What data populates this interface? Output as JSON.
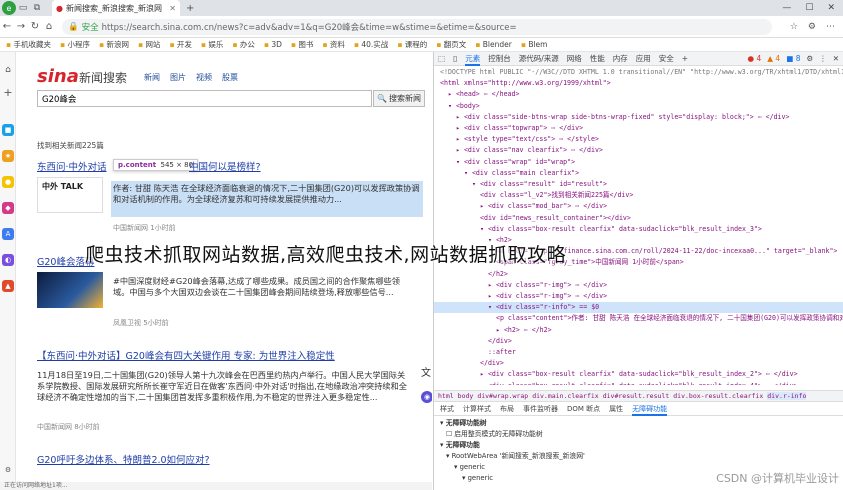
{
  "browser": {
    "tab_title": "新闻搜索_新浪搜索_新浪网",
    "url_secure_label": "安全",
    "url": "https://search.sina.com.cn/news?c=adv&adv=1&q=G20峰会&time=w&stime=&etime=&source=",
    "bookmarks": [
      "手机收藏夹",
      "小程序",
      "新浪网",
      "网站",
      "开发",
      "娱乐",
      "办公",
      "3D",
      "图书",
      "资料",
      "40.实战",
      "课程的",
      "翻页文",
      "Blender",
      "Blem"
    ]
  },
  "page": {
    "logo": "sina",
    "logo_subtitle": "新闻搜索",
    "nav": [
      "新闻",
      "图片",
      "视频",
      "股票"
    ],
    "search": {
      "value": "G20峰会",
      "button": "搜索新闻"
    },
    "result_count": "找到相关新闻225篇",
    "tooltip": {
      "selector": "p.content",
      "size": "545 × 80"
    },
    "results": [
      {
        "title": "东西问·中外对话",
        "title_tail": "中国何以是榜样?",
        "thumb_text": "中外 TALK",
        "body": "作者: 甘甜 陈天浩 在全球经济面临衰退的情况下,二十国集团(G20)可以发挥政策协调和对话机制的作用。为全球经济复苏和可持续发展提供推动力...",
        "meta": "中国新闻网 1小时前"
      },
      {
        "title": "G20峰会落幕",
        "body": "#中国深度财经#G20峰会落幕,达成了哪些成果。成员国之间的合作聚焦哪些领域。中国与多个大国双边会谈在二十国集团峰会期间陆续登场,释放哪些信号...",
        "meta": "凤凰卫视 5小时前"
      },
      {
        "title": "【东西问·中外对话】G20峰会有四大关键作用 专家: 为世界注入稳定性",
        "body": "11月18日至19日,二十国集团(G20)领导人第十九次峰会在巴西里约热内卢举行。中国人民大学国际关系学院教授、国际发展研究所所长崔守军近日在做客'东西问·中外对话'时指出,在地缘政治冲突持续和全球经济不确定性增加的当下,二十国集团首发挥多重积极作用,为不稳定的世界注入更多稳定性...",
        "meta": "中国新闻网 8小时前"
      },
      {
        "title": "G20呼吁多边体系、特朗普2.0如何应对?",
        "body": "",
        "meta": ""
      }
    ],
    "status_text": "正在访问网络地址1项..."
  },
  "overlay_heading": "爬虫技术抓取网站数据,高效爬虫技术,网站数据抓取攻略",
  "devtools": {
    "tabs": [
      "元素",
      "控制台",
      "源代码/来源",
      "网络",
      "性能",
      "内存",
      "应用",
      "安全"
    ],
    "active_tab": "元素",
    "badges": [
      "4",
      "4",
      "8"
    ],
    "dom_lines": [
      {
        "i": 0,
        "t": "<!DOCTYPE html PUBLIC \"-//W3C//DTD XHTML 1.0 transitional//EN\" \"http://www.w3.org/TR/xhtml1/DTD/xhtml1-transitional.dtd\">",
        "c": "cm"
      },
      {
        "i": 0,
        "t": "<html xmlns=\"http://www.w3.org/1999/xhtml\">"
      },
      {
        "i": 1,
        "t": "▸ <head> ⋯ </head>"
      },
      {
        "i": 1,
        "t": "▾ <body>"
      },
      {
        "i": 2,
        "t": "▸ <div class=\"side-btns-wrap side-btns-wrap-fixed\" style=\"display: block;\"> ⋯ </div>"
      },
      {
        "i": 2,
        "t": "▸ <div class=\"topwrap\"> ⋯ </div>"
      },
      {
        "i": 2,
        "t": "▸ <style type=\"text/css\"> ⋯ </style>"
      },
      {
        "i": 2,
        "t": "▸ <div class=\"nav clearfix\"> ⋯ </div>"
      },
      {
        "i": 2,
        "t": "▾ <div class=\"wrap\" id=\"wrap\">"
      },
      {
        "i": 3,
        "t": "▾ <div class=\"main clearfix\">"
      },
      {
        "i": 4,
        "t": "▾ <div class=\"result\" id=\"result\">"
      },
      {
        "i": 5,
        "t": "<div class=\"l_v2\">找到相关新闻225篇</div>"
      },
      {
        "i": 5,
        "t": "▸ <div class=\"mod_bar\"> ⋯ </div>"
      },
      {
        "i": 5,
        "t": "<div id=\"news_result_container\"></div>"
      },
      {
        "i": 5,
        "t": "▾ <div class=\"box-result clearfix\" data-sudaclick=\"blk_result_index_3\">"
      },
      {
        "i": 6,
        "t": "▾ <h2>"
      },
      {
        "i": 7,
        "t": "<a href=\"https://finance.sina.com.cn/roll/2024-11-22/doc-incexaa0...\" target=\"_blank\">"
      },
      {
        "i": 7,
        "t": "<span class=\"fgray_time\">中国新闻网 1小时前</span>"
      },
      {
        "i": 6,
        "t": "</h2>"
      },
      {
        "i": 6,
        "t": "▸ <div class=\"r-img\"> ⋯ </div>"
      },
      {
        "i": 6,
        "t": "▸ <div class=\"r-img\"> ⋯ </div>"
      },
      {
        "i": 6,
        "t": "▾ <div class=\"r-info\"> == $0",
        "sel": true
      },
      {
        "i": 7,
        "t": "<p class=\"content\">作者: 甘甜 陈天浩 在全球经济面临衰退的情况下, 二十国集团(G20)可以发挥政策协调和对话机制的作用。为全球经济复苏和可持续发展提供推动力...</p>"
      },
      {
        "i": 7,
        "t": "▸ <h2> ⋯ </h2>"
      },
      {
        "i": 6,
        "t": "</div>"
      },
      {
        "i": 6,
        "t": "::after"
      },
      {
        "i": 5,
        "t": "</div>"
      },
      {
        "i": 5,
        "t": "▸ <div class=\"box-result clearfix\" data-sudaclick=\"blk_result_index_2\"> ⋯ </div>"
      },
      {
        "i": 5,
        "t": "▸ <div class=\"box-result clearfix\" data-sudaclick=\"blk_result_index_4\"> ⋯ </div>"
      }
    ],
    "crumbs": [
      "html",
      "body",
      "div#wrap.wrap",
      "div.main.clearfix",
      "div#result.result",
      "div.box-result.clearfix",
      "div.r-info"
    ],
    "subtabs": [
      "样式",
      "计算样式",
      "布局",
      "事件监听器",
      "DOM 断点",
      "属性",
      "无障碍功能"
    ],
    "active_subtab": "无障碍功能",
    "a11y": {
      "section1": "无障碍功能树",
      "check": "启用整页模式的无障碍功能树",
      "section2": "无障碍功能",
      "root": "RootWebArea '新闻搜索_新浪搜索_新浪网'",
      "generic": "generic"
    }
  },
  "watermark": "CSDN @计算机毕业设计"
}
